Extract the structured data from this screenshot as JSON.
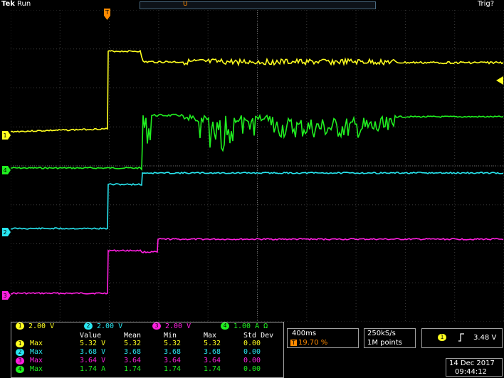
{
  "header": {
    "brand": "Tek",
    "state": "Run",
    "trigger_status": "Trig?",
    "trigger_position_marker": "U"
  },
  "colors": {
    "ch1": "#ffff20",
    "ch2": "#28e6f0",
    "ch3": "#ff20e0",
    "ch4": "#20f020",
    "trigger_marker": "#ff8a00",
    "graticule": "#4a4a4a"
  },
  "channel_markers": [
    {
      "label": "1",
      "color": "#ffff20"
    },
    {
      "label": "4",
      "color": "#20f020"
    },
    {
      "label": "2",
      "color": "#28e6f0"
    },
    {
      "label": "3",
      "color": "#ff20e0"
    }
  ],
  "scales": [
    {
      "channel": "1",
      "value": "2.00 V",
      "color": "#ffff20"
    },
    {
      "channel": "2",
      "value": "2.00 V",
      "color": "#28e6f0"
    },
    {
      "channel": "3",
      "value": "2.00 V",
      "color": "#ff20e0"
    },
    {
      "channel": "4",
      "value": "1.00 A",
      "suffix": "Ω",
      "color": "#20f020"
    }
  ],
  "measurements": {
    "headers": [
      "Value",
      "Mean",
      "Min",
      "Max",
      "Std Dev"
    ],
    "rows": [
      {
        "channel": "1",
        "type": "Max",
        "color": "#ffff20",
        "value": "5.32 V",
        "mean": "5.32",
        "min": "5.32",
        "max": "5.32",
        "std": "0.00"
      },
      {
        "channel": "2",
        "type": "Max",
        "color": "#28e6f0",
        "value": "3.68 V",
        "mean": "3.68",
        "min": "3.68",
        "max": "3.68",
        "std": "0.00"
      },
      {
        "channel": "3",
        "type": "Max",
        "color": "#ff20e0",
        "value": "3.64 V",
        "mean": "3.64",
        "min": "3.64",
        "max": "3.64",
        "std": "0.00"
      },
      {
        "channel": "4",
        "type": "Max",
        "color": "#20f020",
        "value": "1.74 A",
        "mean": "1.74",
        "min": "1.74",
        "max": "1.74",
        "std": "0.00"
      }
    ]
  },
  "timebase": {
    "scale": "400ms",
    "position": "19.70 %"
  },
  "sampling": {
    "rate": "250kS/s",
    "length": "1M points"
  },
  "trigger": {
    "channel": "1",
    "slope_icon": "rising-edge-icon",
    "level": "3.48 V"
  },
  "datetime": {
    "date": "14 Dec  2017",
    "time": "09:44:12"
  }
}
